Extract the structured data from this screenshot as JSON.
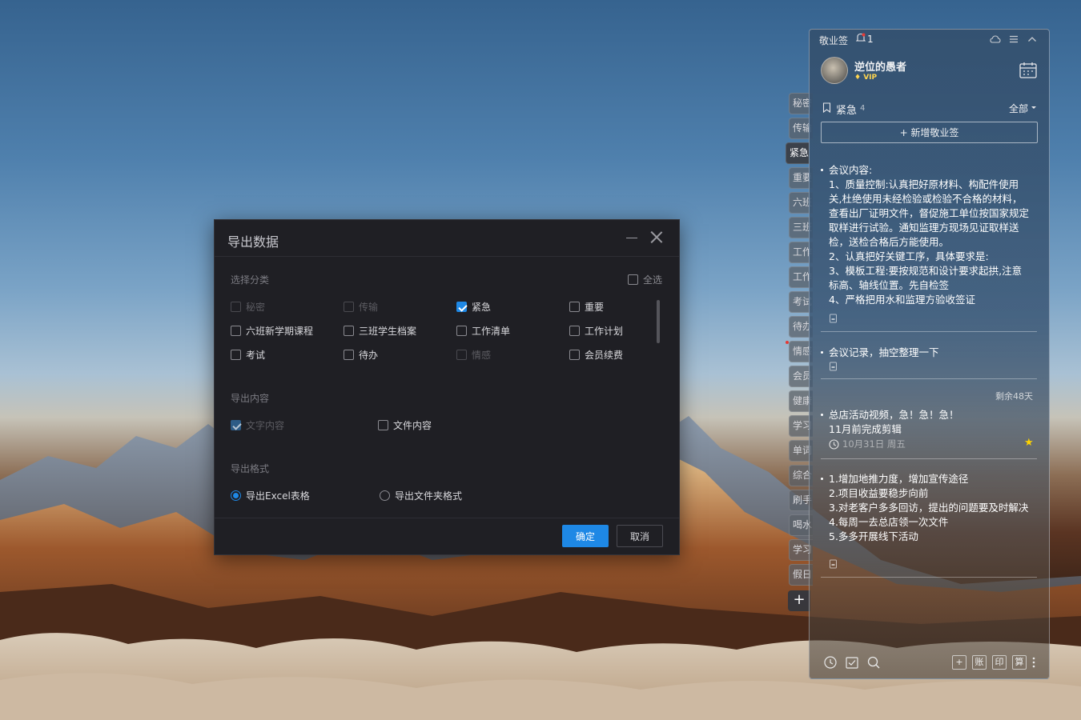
{
  "dialog": {
    "title": "导出数据",
    "category_label": "选择分类",
    "select_all": "全选",
    "categories": [
      {
        "label": "秘密",
        "checked": false,
        "disabled": true
      },
      {
        "label": "传输",
        "checked": false,
        "disabled": true
      },
      {
        "label": "紧急",
        "checked": true,
        "disabled": false
      },
      {
        "label": "重要",
        "checked": false,
        "disabled": false
      },
      {
        "label": "六班新学期课程",
        "checked": false,
        "disabled": false
      },
      {
        "label": "三班学生档案",
        "checked": false,
        "disabled": false
      },
      {
        "label": "工作清单",
        "checked": false,
        "disabled": false
      },
      {
        "label": "工作计划",
        "checked": false,
        "disabled": false
      },
      {
        "label": "考试",
        "checked": false,
        "disabled": false
      },
      {
        "label": "待办",
        "checked": false,
        "disabled": false
      },
      {
        "label": "情感",
        "checked": false,
        "disabled": true
      },
      {
        "label": "会员续费",
        "checked": false,
        "disabled": false
      }
    ],
    "content_label": "导出内容",
    "content_options": [
      {
        "label": "文字内容",
        "checked": true,
        "disabled": true
      },
      {
        "label": "文件内容",
        "checked": false,
        "disabled": false
      }
    ],
    "format_label": "导出格式",
    "format_options": [
      {
        "label": "导出Excel表格",
        "selected": true
      },
      {
        "label": "导出文件夹格式",
        "selected": false
      }
    ],
    "ok_label": "确定",
    "cancel_label": "取消"
  },
  "side_tabs": [
    "秘密",
    "传输",
    "紧急",
    "重要",
    "六班",
    "三班",
    "工作",
    "工作",
    "考试",
    "待办",
    "情感",
    "会员",
    "健康",
    "学习",
    "单词",
    "综合",
    "刷手",
    "喝水",
    "学习",
    "假日"
  ],
  "active_tab": "紧急",
  "panel": {
    "app_title": "敬业签",
    "notification_count": "1",
    "user_name": "逆位的愚者",
    "vip_label": "VIP",
    "category_name": "紧急",
    "category_count": "4",
    "filter_label": "全部",
    "add_label": "+ 新增敬业签",
    "notes": [
      {
        "text": "会议内容:\n1、质量控制:认真把好原材料、构配件使用关,杜绝使用未经检验或检验不合格的材料，查看出厂证明文件，督促施工单位按国家规定取样进行试验。通知监理方现场见证取样送检，送检合格后方能使用。\n2、认真把好关键工序，具体要求是:\n3、模板工程:要按规范和设计要求起拱,注意标高、轴线位置。先自检签\n4、严格把用水和监理方验收签证"
      },
      {
        "text": "会议记录，抽空整理一下"
      },
      {
        "text": "总店活动视频，急！急！急！\n11月前完成剪辑",
        "remaining": "剩余48天",
        "date": "10月31日 周五",
        "starred": true
      },
      {
        "text": "1.增加地推力度，增加宣传途径\n2.项目收益要稳步向前\n3.对老客户多多回访，提出的问题要及时解决\n4.每周一去总店领一次文件\n5.多多开展线下活动"
      }
    ],
    "bottom_tools": [
      "账",
      "印",
      "算"
    ]
  }
}
